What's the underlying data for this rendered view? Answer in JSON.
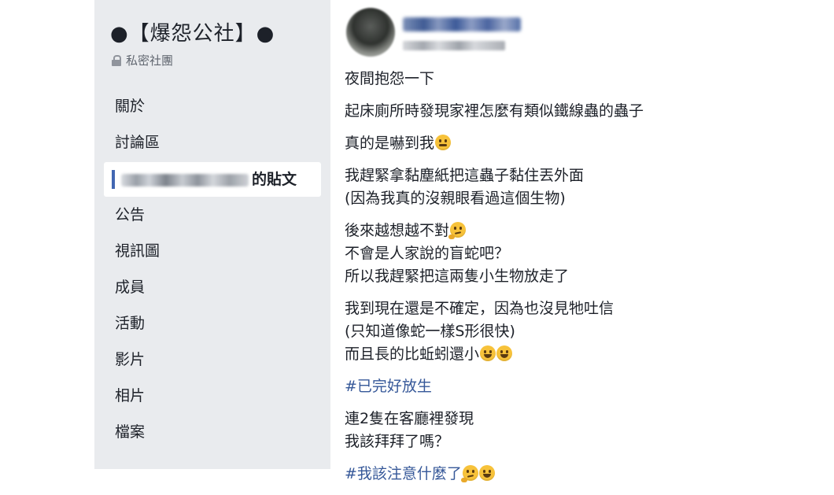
{
  "sidebar": {
    "group_name": "●【爆怨公社】●",
    "privacy_label": "私密社團",
    "nav": [
      {
        "label": "關於"
      },
      {
        "label": "討論區"
      },
      {
        "label": "的貼文"
      },
      {
        "label": "公告"
      },
      {
        "label": "視訊圖"
      },
      {
        "label": "成員"
      },
      {
        "label": "活動"
      },
      {
        "label": "影片"
      },
      {
        "label": "相片"
      },
      {
        "label": "檔案"
      }
    ]
  },
  "post": {
    "paragraphs": [
      [
        "夜間抱怨一下"
      ],
      [
        "起床廁所時發現家裡怎麼有類似鐵線蟲的蟲子"
      ],
      [
        "真的是嚇到我"
      ],
      [
        "我趕緊拿黏塵紙把這蟲子黏住丟外面",
        "(因為我真的沒親眼看過這個生物)"
      ],
      [
        "後來越想越不對",
        "不會是人家說的盲蛇吧？",
        "所以我趕緊把這兩隻小生物放走了"
      ],
      [
        "我到現在還是不確定，因為也沒見牠吐信",
        "(只知道像蛇一樣S形很快)",
        "而且長的比蚯蚓還小"
      ]
    ],
    "hashtag1": "#已完好放生",
    "paragraph_after": [
      "連2隻在客廳裡發現",
      "我該拜拜了嗎？"
    ],
    "hashtag2": "#我該注意什麼了"
  },
  "emojis": {
    "tired": "tired-face-emoji",
    "thinking": "thinking-face-emoji",
    "grin": "grinning-face-emoji",
    "joy": "face-with-tears-of-joy-emoji"
  },
  "colors": {
    "sidebar_bg": "#e9ebee",
    "link": "#365899",
    "text": "#1d2129",
    "accent": "#4267b2"
  }
}
